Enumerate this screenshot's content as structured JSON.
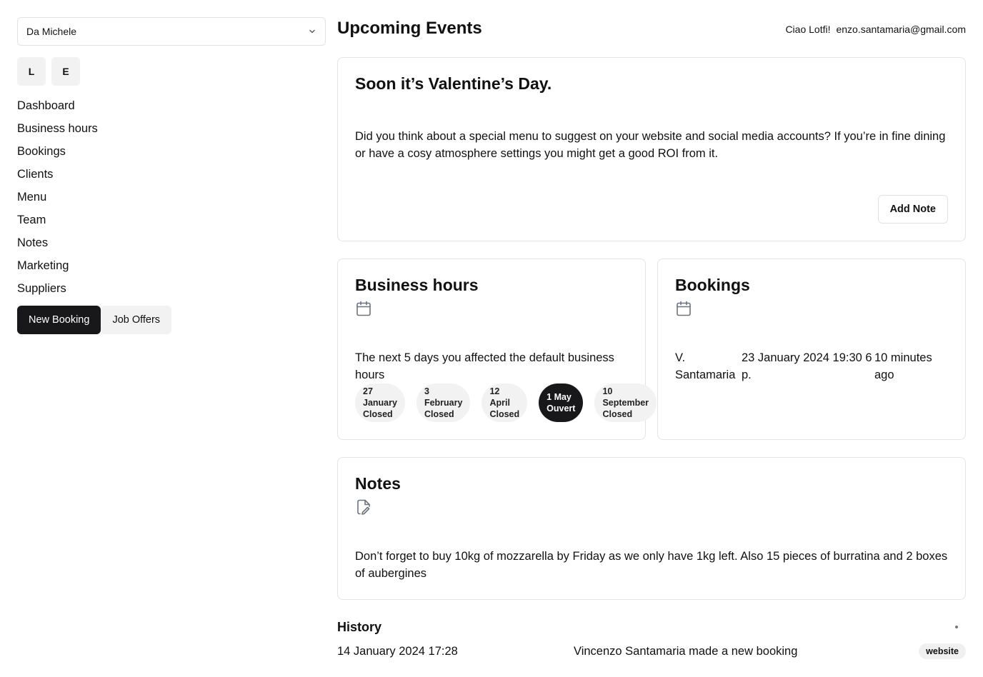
{
  "sidebar": {
    "restaurant_select": "Da Michele",
    "avatars": [
      "L",
      "E"
    ],
    "nav": [
      "Dashboard",
      "Business hours",
      "Bookings",
      "Clients",
      "Menu",
      "Team",
      "Notes",
      "Marketing",
      "Suppliers"
    ],
    "new_booking_label": "New Booking",
    "job_offers_label": "Job Offers"
  },
  "header": {
    "title": "Upcoming Events",
    "greeting": "Ciao Lotfi!",
    "email": "enzo.santamaria@gmail.com"
  },
  "valentine": {
    "title": "Soon it’s Valentine’s Day.",
    "body": "Did you think about a special menu to suggest on your website and social media accounts? If you’re in fine dining or have a cosy atmosphere settings you might get a good ROI from it.",
    "button": "Add Note"
  },
  "business_hours": {
    "title": "Business hours",
    "icon": "calendar-icon",
    "body": "The next 5 days you affected the default business hours",
    "days": [
      {
        "date_line1": "27",
        "date_line2": "January",
        "status": "Closed"
      },
      {
        "date_line1": "3",
        "date_line2": "February",
        "status": "Closed"
      },
      {
        "date_line1": "12",
        "date_line2": "April",
        "status": "Closed"
      },
      {
        "date_line1": "1 May",
        "date_line2": "",
        "status": "Ouvert"
      },
      {
        "date_line1": "10",
        "date_line2": "September",
        "status": "Closed"
      }
    ]
  },
  "bookings": {
    "title": "Bookings",
    "icon": "calendar-icon",
    "row": {
      "name": "V. Santamaria",
      "when": "23 January 2024 19:30 6 p.",
      "ago": "10 minutes ago"
    }
  },
  "notes": {
    "title": "Notes",
    "icon": "file-edit-icon",
    "body": "Don’t forget to buy 10kg of mozzarella by Friday as we only have 1kg left. Also 15 pieces of burratina and 2 boxes of aubergines"
  },
  "history": {
    "title": "History",
    "rows": [
      {
        "date": "14 January 2024 17:28",
        "text": "Vincenzo Santamaria made a new booking",
        "badge": "website"
      }
    ]
  }
}
